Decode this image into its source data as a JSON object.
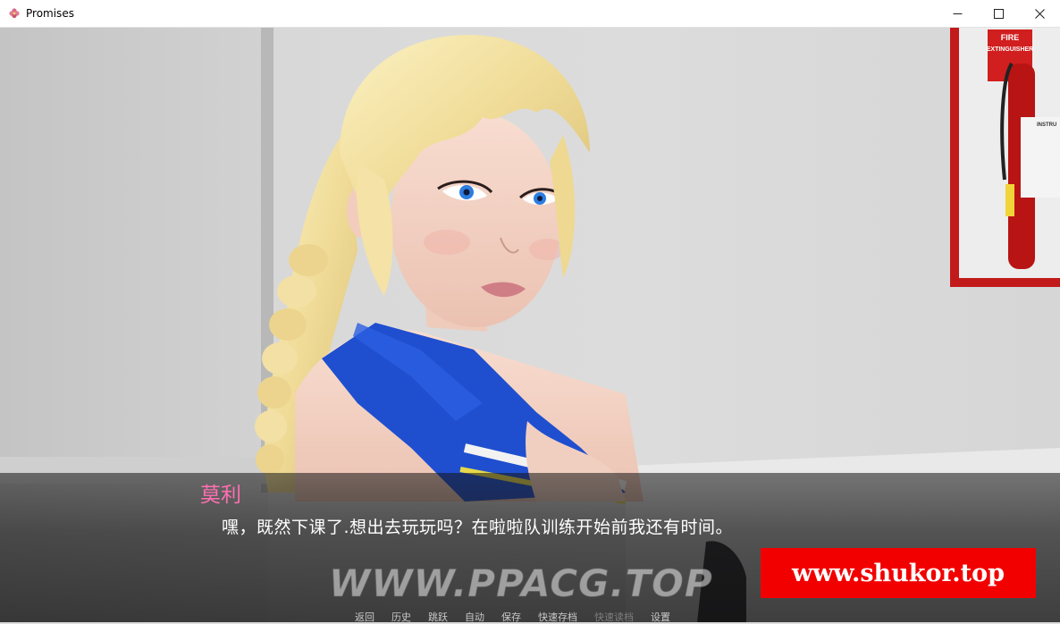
{
  "window": {
    "title": "Promises",
    "icon": "flower-icon",
    "controls": {
      "minimize": "—",
      "maximize": "☐",
      "close": "✕"
    }
  },
  "dialogue": {
    "speaker": "莫利",
    "text": "嘿，既然下课了.想出去玩玩吗？在啦啦队训练开始前我还有时间。",
    "speaker_color": "#ff6fb2"
  },
  "scene": {
    "sign_text_1": "FIRE",
    "sign_text_2": "EXTINGUISHER",
    "sign_text_3": "INSTRU"
  },
  "watermarks": {
    "ppacg": "WWW.PPACG.TOP",
    "shukor": "www.shukor.top"
  },
  "quick_menu": [
    {
      "label": "返回",
      "enabled": true
    },
    {
      "label": "历史",
      "enabled": true
    },
    {
      "label": "跳跃",
      "enabled": true
    },
    {
      "label": "自动",
      "enabled": true
    },
    {
      "label": "保存",
      "enabled": true
    },
    {
      "label": "快速存档",
      "enabled": true
    },
    {
      "label": "快速读档",
      "enabled": false
    },
    {
      "label": "设置",
      "enabled": true
    }
  ]
}
